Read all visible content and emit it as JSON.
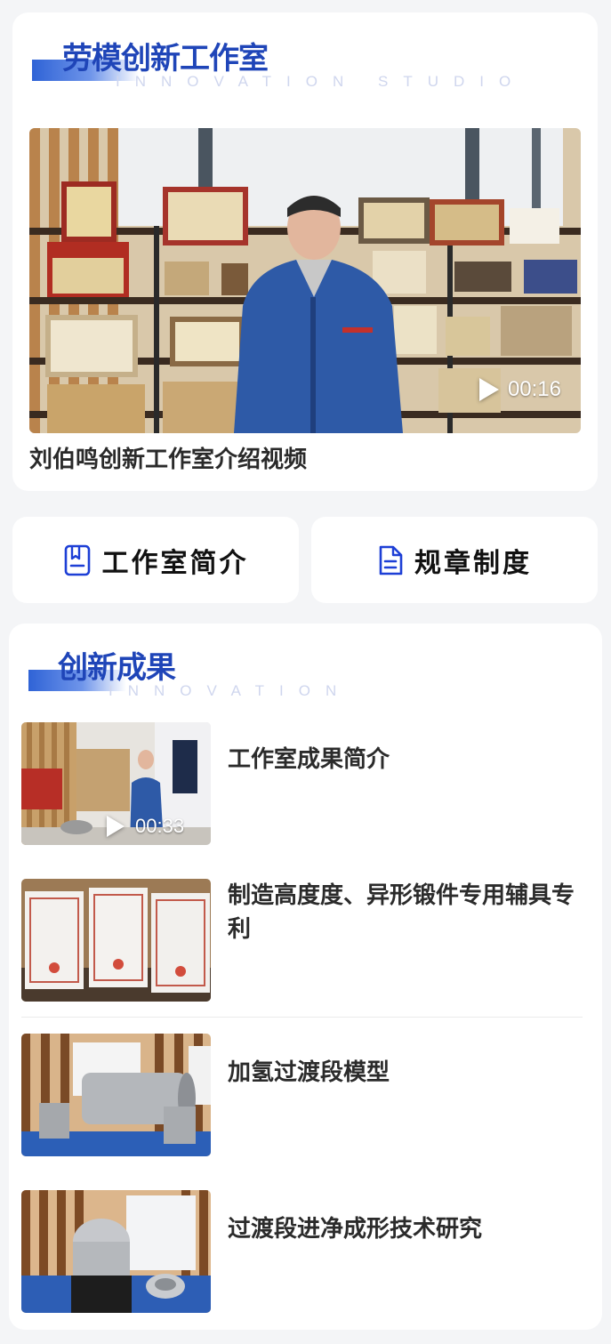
{
  "studio": {
    "title": "劳模创新工作室",
    "subtitle": "INNOVATION STUDIO",
    "video": {
      "duration": "00:16",
      "title": "刘伯鸣创新工作室介绍视频"
    }
  },
  "nav_buttons": [
    {
      "label": "工作室简介",
      "icon": "bookmark-doc-icon"
    },
    {
      "label": "规章制度",
      "icon": "document-icon"
    }
  ],
  "achievements": {
    "title": "创新成果",
    "subtitle": "INNOVATION",
    "items": [
      {
        "title": "工作室成果简介",
        "duration": "00:33",
        "is_video": true
      },
      {
        "title": "制造高度度、异形锻件专用辅具专利",
        "is_video": false
      },
      {
        "title": "加氢过渡段模型",
        "is_video": false
      },
      {
        "title": "过渡段进净成形技术研究",
        "is_video": false
      }
    ]
  },
  "colors": {
    "accent": "#1f45b8",
    "icon_blue": "#1d3fd6",
    "page_bg": "#f4f5f7"
  }
}
